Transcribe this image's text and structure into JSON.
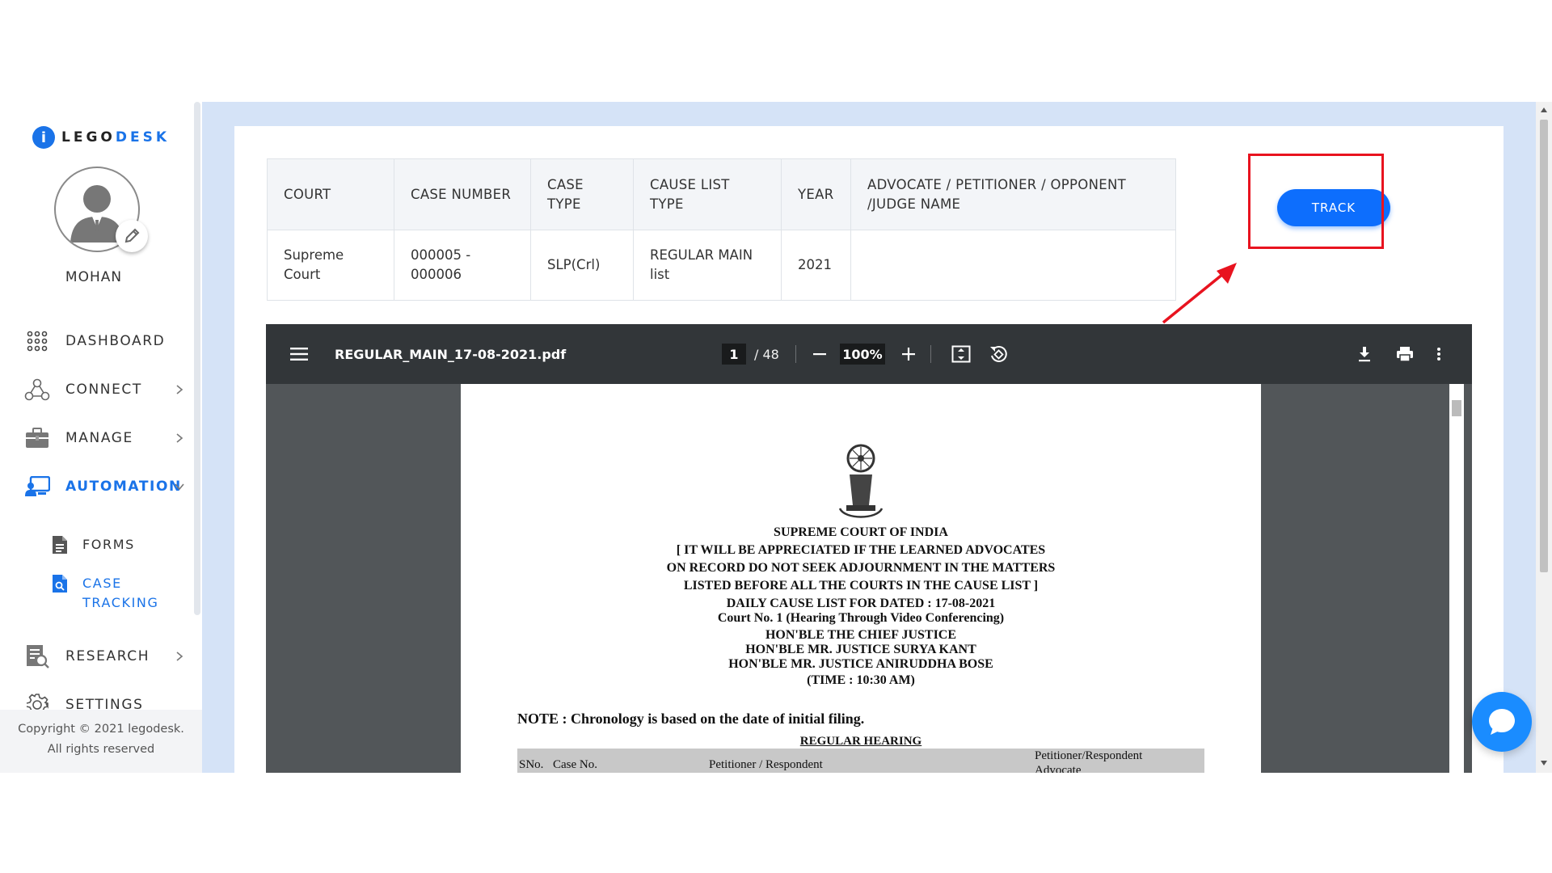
{
  "brand": {
    "logo_lego": "LEGO",
    "logo_desk": "DESK"
  },
  "user": {
    "name": "MOHAN"
  },
  "sidebar": {
    "items": [
      {
        "label": "DASHBOARD",
        "icon": "grid-dots-icon"
      },
      {
        "label": "CONNECT",
        "icon": "network-icon"
      },
      {
        "label": "MANAGE",
        "icon": "briefcase-icon"
      },
      {
        "label": "AUTOMATION",
        "icon": "automation-icon"
      },
      {
        "label": "RESEARCH",
        "icon": "research-icon"
      },
      {
        "label": "SETTINGS",
        "icon": "gear-icon"
      }
    ],
    "subitems": [
      {
        "label": "FORMS",
        "icon": "document-icon"
      },
      {
        "label": "CASE TRACKING",
        "icon": "case-file-icon"
      }
    ],
    "copyright_line1": "Copyright © 2021 legodesk.",
    "copyright_line2": "All rights reserved"
  },
  "case_table": {
    "headers": [
      "COURT",
      "CASE NUMBER",
      "CASE TYPE",
      "CAUSE LIST TYPE",
      "YEAR",
      "ADVOCATE / PETITIONER / OPPONENT /JUDGE NAME"
    ],
    "row": [
      "Supreme Court",
      "000005 - 000006",
      "SLP(Crl)",
      "REGULAR MAIN list",
      "2021",
      ""
    ]
  },
  "track_button": {
    "label": "TRACK"
  },
  "pdf": {
    "filename": "REGULAR_MAIN_17-08-2021.pdf",
    "current_page": "1",
    "total_pages": "/ 48",
    "zoom": "100%",
    "header_lines": [
      "SUPREME COURT OF INDIA",
      "[ IT WILL BE APPRECIATED IF THE LEARNED ADVOCATES",
      "ON RECORD DO NOT SEEK ADJOURNMENT IN THE MATTERS",
      "LISTED BEFORE ALL THE COURTS IN THE CAUSE LIST ]",
      "DAILY CAUSE LIST FOR DATED : 17-08-2021",
      "Court No. 1 (Hearing Through Video Conferencing)",
      "HON'BLE THE CHIEF JUSTICE",
      "HON'BLE MR. JUSTICE SURYA KANT",
      "HON'BLE MR. JUSTICE ANIRUDDHA BOSE",
      "(TIME : 10:30 AM)"
    ],
    "note": "NOTE : Chronology is based on the date of initial filing.",
    "section_title": "REGULAR HEARING",
    "table_headers": [
      "SNo.",
      "Case No.",
      "Petitioner / Respondent",
      "Petitioner/Respondent Advocate"
    ]
  },
  "colors": {
    "accent": "#1a73e8",
    "track_button": "#0d6efd",
    "highlight_box": "#e8131f",
    "main_bg": "#d5e3f7",
    "pdf_toolbar": "#323639"
  }
}
